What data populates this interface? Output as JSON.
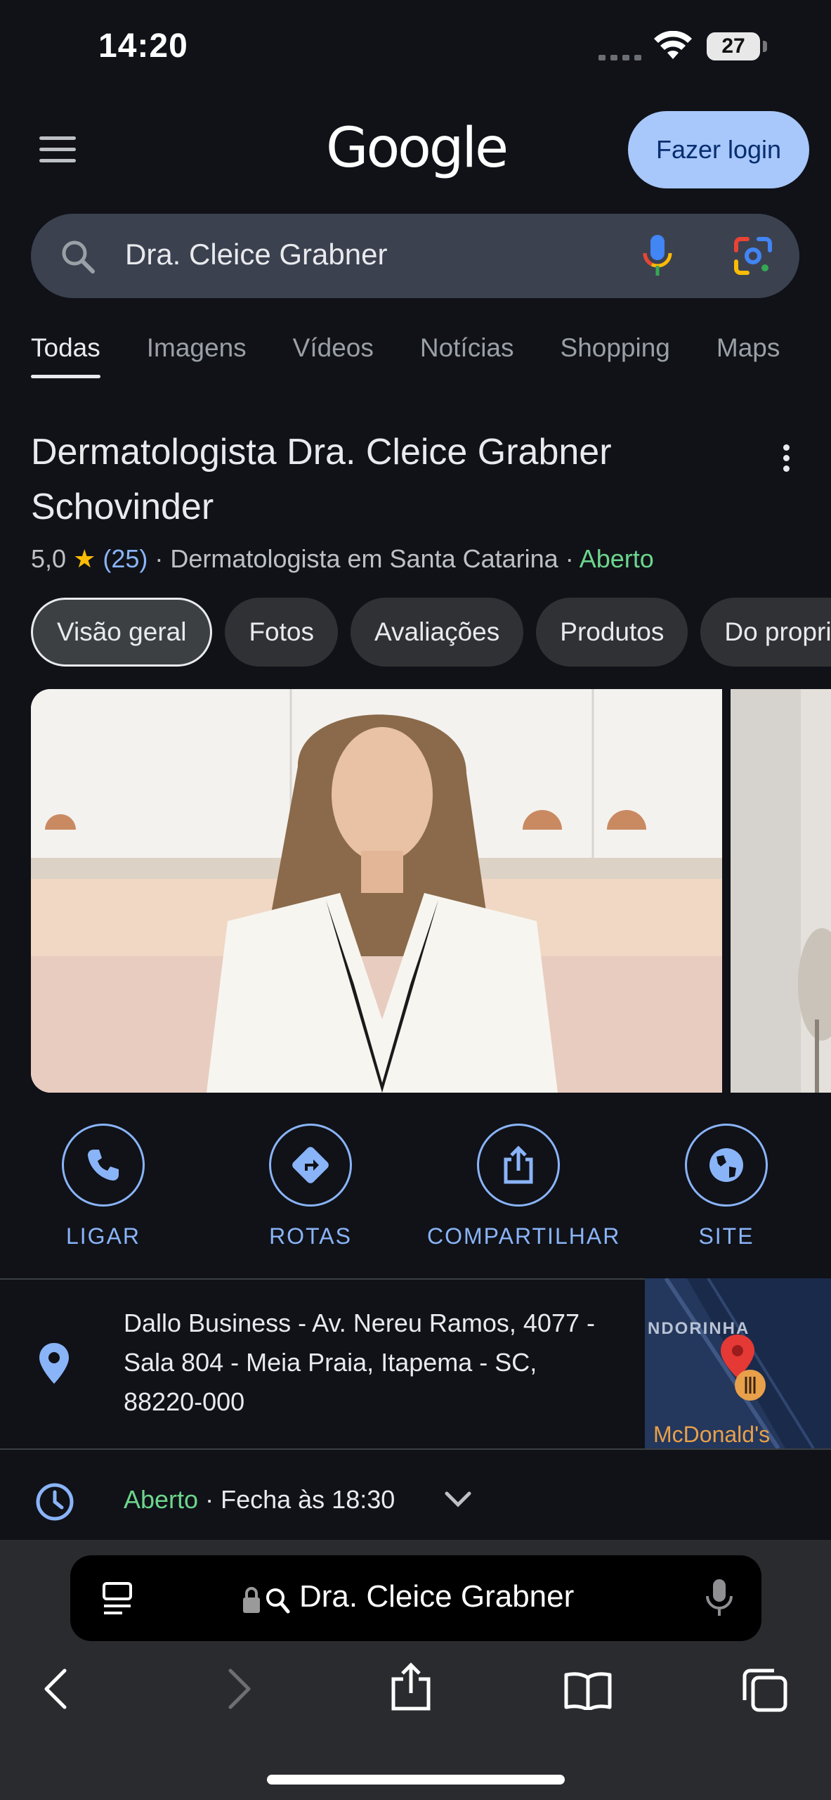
{
  "status_bar": {
    "time": "14:20",
    "battery": "27"
  },
  "header": {
    "logo": "Google",
    "login_label": "Fazer login"
  },
  "search": {
    "query": "Dra. Cleice Grabner"
  },
  "tabs": [
    "Todas",
    "Imagens",
    "Vídeos",
    "Notícias",
    "Shopping",
    "Maps"
  ],
  "knowledge_panel": {
    "title": "Dermatologista Dra. Cleice Grabner Schovinder",
    "rating": "5,0",
    "reviews": "(25)",
    "category": "Dermatologista em Santa Catarina",
    "status": "Aberto",
    "chips": [
      "Visão geral",
      "Fotos",
      "Avaliações",
      "Produtos",
      "Do proprietário"
    ],
    "actions": [
      "LIGAR",
      "ROTAS",
      "COMPARTILHAR",
      "SITE"
    ],
    "address": "Dallo Business - Av. Nereu Ramos, 4077 - Sala 804 - Meia Praia, Itapema - SC, 88220-000",
    "map_labels": [
      "NDORINHA",
      "McDonald's"
    ],
    "hours_status": "Aberto",
    "hours_detail": "Fecha às 18:30"
  },
  "safari": {
    "url_text": "Dra. Cleice Grabner"
  },
  "colors": {
    "accent": "#8ab4f8",
    "open": "#6dd58c",
    "login_bg": "#a8c7fa",
    "background": "#101218"
  }
}
